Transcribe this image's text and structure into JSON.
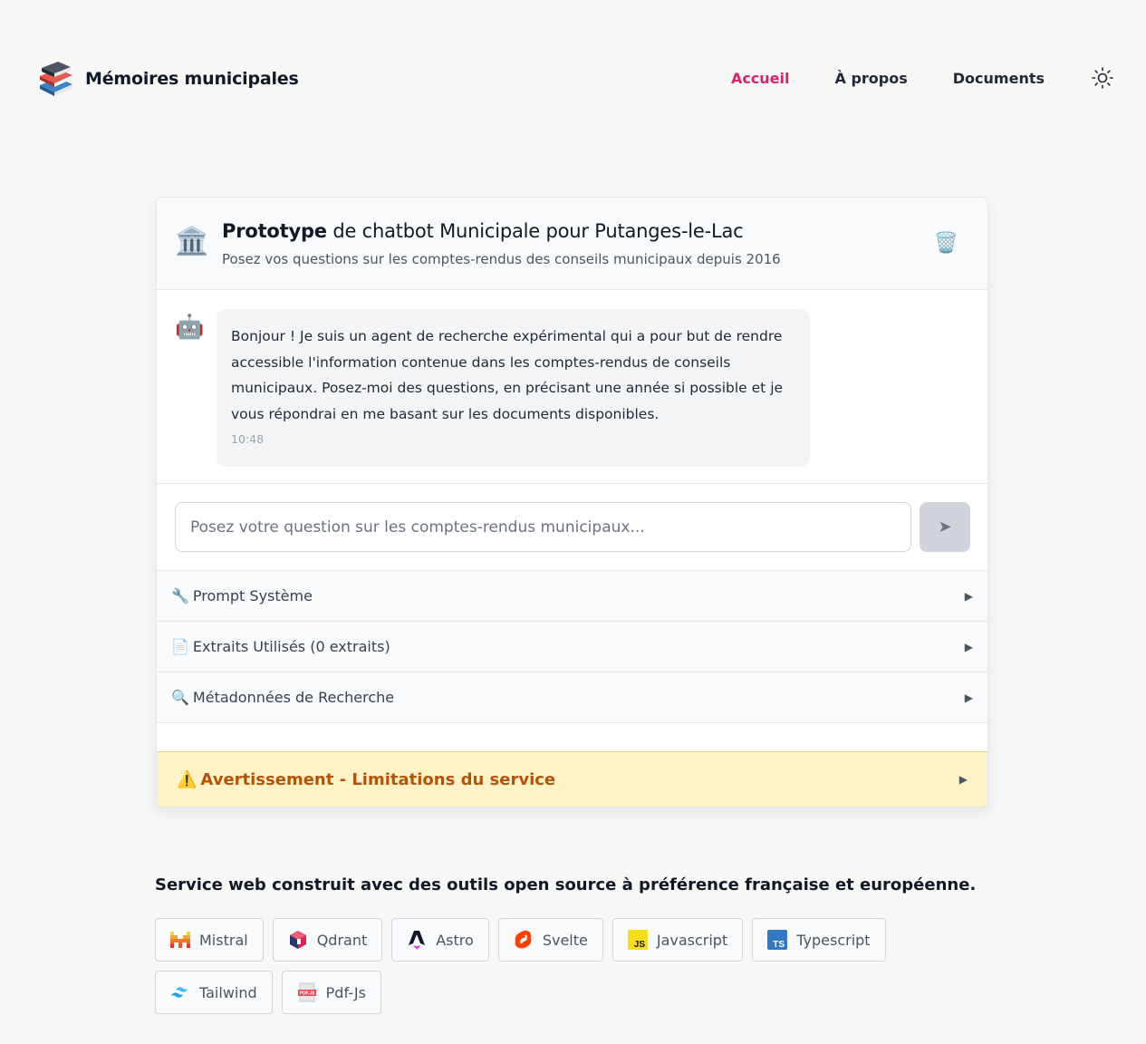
{
  "header": {
    "brand": "Mémoires municipales",
    "nav": [
      {
        "label": "Accueil",
        "active": true
      },
      {
        "label": "À propos",
        "active": false
      },
      {
        "label": "Documents",
        "active": false
      }
    ],
    "theme_icon": "sun-icon"
  },
  "chat": {
    "title_bold": "Prototype",
    "title_rest": " de chatbot Municipale pour Putanges-le-Lac",
    "subtitle": "Posez vos questions sur les comptes-rendus des conseils municipaux depuis 2016",
    "header_icon": "🏛️",
    "clear_icon": "🗑️",
    "messages": [
      {
        "role": "bot",
        "avatar": "🤖",
        "text": "Bonjour ! Je suis un agent de recherche expérimental qui a pour but de rendre accessible l'information contenue dans les comptes-rendus de conseils municipaux. Posez-moi des questions, en précisant une année si possible et je vous répondrai en me basant sur les documents disponibles.",
        "time": "10:48"
      }
    ],
    "input": {
      "placeholder": "Posez votre question sur les comptes-rendus municipaux...",
      "value": "",
      "send_glyph": "➤"
    },
    "sections": [
      {
        "icon": "🔧",
        "label": "Prompt Système"
      },
      {
        "icon": "📄",
        "label": "Extraits Utilisés (0 extraits)"
      },
      {
        "icon": "🔍",
        "label": "Métadonnées de Recherche"
      }
    ],
    "warning": {
      "icon": "⚠️",
      "label": "Avertissement - Limitations du service"
    },
    "caret": "▶"
  },
  "footer": {
    "title": "Service web construit avec des outils open source à préférence française et européenne.",
    "tools": [
      {
        "label": "Mistral",
        "icon": "mistral-icon"
      },
      {
        "label": "Qdrant",
        "icon": "qdrant-icon"
      },
      {
        "label": "Astro",
        "icon": "astro-icon"
      },
      {
        "label": "Svelte",
        "icon": "svelte-icon"
      },
      {
        "label": "Javascript",
        "icon": "javascript-icon"
      },
      {
        "label": "Typescript",
        "icon": "typescript-icon"
      },
      {
        "label": "Tailwind",
        "icon": "tailwind-icon"
      },
      {
        "label": "Pdf-Js",
        "icon": "pdfjs-icon"
      }
    ]
  },
  "colors": {
    "accent": "#d3266d",
    "warning_bg": "#fef3c7",
    "warning_text": "#b45309"
  }
}
